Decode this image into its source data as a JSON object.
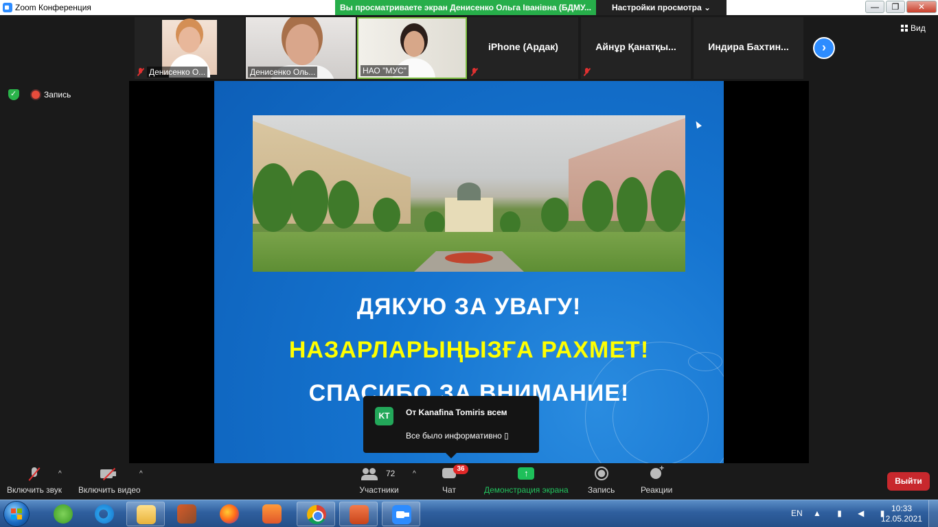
{
  "window": {
    "title": "Zoom Конференция",
    "share_banner": "Вы просматриваете экран Денисенко Ольга Іванівна (БДМУ...",
    "view_options": "Настройки просмотра ⌄",
    "controls": {
      "minimize": "—",
      "maximize": "❐",
      "close": "✕"
    }
  },
  "strip": {
    "tiles": [
      {
        "label": "Денисенко О...",
        "muted": true
      },
      {
        "label": "Денисенко Оль..."
      },
      {
        "label": "НАО \"МУС\"",
        "active": true
      },
      {
        "label": "iPhone (Ардак)",
        "muted": true
      },
      {
        "label": "Айнұр Қанатқы...",
        "muted": true
      },
      {
        "label": "Индира  Бахтин..."
      }
    ],
    "next_label": "›",
    "view_label": "Вид"
  },
  "status": {
    "recording_label": "Запись"
  },
  "slide": {
    "line1": "ДЯКУЮ ЗА УВАГУ!",
    "line2": "НАЗАРЛАРЫҢЫЗҒА РАХМЕТ!",
    "line3": "СПАСИБО ЗА ВНИМАНИЕ!",
    "colors": {
      "background": "#1574d0",
      "highlight": "#ffff00"
    }
  },
  "chat_toast": {
    "avatar_initials": "KT",
    "from": "От Kanafina Tomiris всем",
    "message": "Все было информативно ▯"
  },
  "toolbar": {
    "audio_label": "Включить звук",
    "video_label": "Включить видео",
    "participants_count": "72",
    "participants_label": "Участники",
    "chat_label": "Чат",
    "chat_badge": "36",
    "share_label": "Демонстрация экрана",
    "record_label": "Запись",
    "reactions_label": "Реакции",
    "leave_label": "Выйти",
    "caret": "^",
    "colors": {
      "share": "#1ec05a",
      "leave": "#c8282d"
    }
  },
  "taskbar": {
    "apps": [
      "utorrent-icon",
      "internet-explorer-icon",
      "file-explorer-icon",
      "tool-icon",
      "firefox-icon",
      "media-player-icon",
      "chrome-icon",
      "powerpoint-icon",
      "zoom-icon"
    ],
    "language": "EN",
    "tray": "▲ ▮ ◀ ▮",
    "time": "10:33",
    "date": "12.05.2021"
  }
}
